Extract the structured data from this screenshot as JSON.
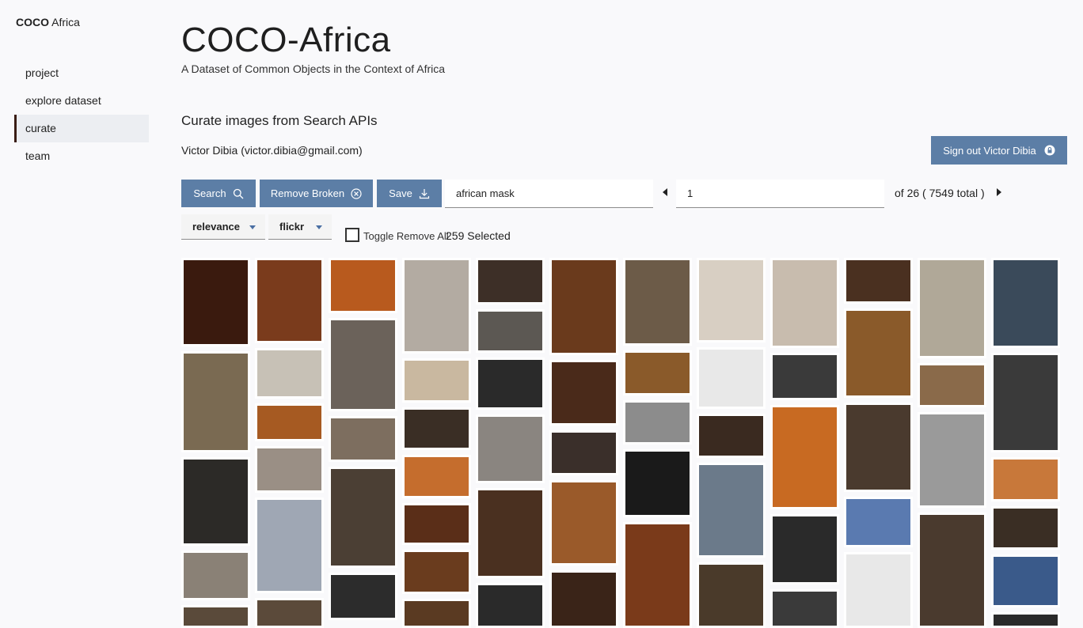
{
  "brand": {
    "bold": "COCO",
    "rest": "Africa"
  },
  "nav": {
    "items": [
      {
        "label": "project"
      },
      {
        "label": "explore dataset"
      },
      {
        "label": "curate"
      },
      {
        "label": "team"
      }
    ]
  },
  "header": {
    "title": "COCO-Africa",
    "subtitle": "A Dataset of Common Objects in the Context of Africa"
  },
  "curate": {
    "section_title": "Curate images from Search APIs",
    "user": "Victor Dibia (victor.dibia@gmail.com)",
    "signout_label": "Sign out Victor Dibia"
  },
  "toolbar": {
    "search_label": "Search",
    "remove_broken_label": "Remove Broken",
    "save_label": "Save",
    "query_value": "african mask",
    "page_value": "1",
    "of_total": "of 26 ( 7549 total )",
    "sort_value": "relevance",
    "source_value": "flickr",
    "toggle_label": "Toggle Remove All",
    "selected_text": "259 Selected"
  },
  "colors": {
    "accent": "#5c7ea6",
    "active_nav": "#3a1d14"
  },
  "icons": [
    "search-icon",
    "close-circle-icon",
    "download-icon",
    "lock-icon",
    "caret-left-icon",
    "caret-right-icon",
    "chevron-down-icon"
  ],
  "grid": {
    "columns": [
      [
        [
          115,
          "#3a1a0e"
        ],
        [
          130,
          "#7a6a52"
        ],
        [
          115,
          "#2c2a27"
        ],
        [
          64,
          "#8a8176"
        ],
        [
          30,
          "#5a4a3a"
        ]
      ],
      [
        [
          115,
          "#7a3b1c"
        ],
        [
          68,
          "#c7c1b6"
        ],
        [
          52,
          "#a65a22"
        ],
        [
          62,
          "#9a8f85"
        ],
        [
          130,
          "#9fa7b4"
        ],
        [
          40,
          "#5b4a3a"
        ]
      ],
      [
        [
          70,
          "#b85a1e"
        ],
        [
          118,
          "#6b625a"
        ],
        [
          58,
          "#7d6e5f"
        ],
        [
          128,
          "#4b3f34"
        ],
        [
          60,
          "#2c2c2c"
        ]
      ],
      [
        [
          130,
          "#b3aba2"
        ],
        [
          60,
          "#c9b8a0"
        ],
        [
          58,
          "#3a2e25"
        ],
        [
          60,
          "#c56d2d"
        ],
        [
          56,
          "#5a2e18"
        ],
        [
          60,
          "#6a3c1e"
        ],
        [
          40,
          "#5a3a22"
        ]
      ],
      [
        [
          62,
          "#3d2f27"
        ],
        [
          58,
          "#5c5853"
        ],
        [
          70,
          "#2a2a2a"
        ],
        [
          92,
          "#8a8580"
        ],
        [
          120,
          "#4a3020"
        ],
        [
          60,
          "#2a2a2a"
        ]
      ],
      [
        [
          136,
          "#6a3a1c"
        ],
        [
          92,
          "#4a2a1a"
        ],
        [
          62,
          "#3a2f2a"
        ],
        [
          120,
          "#9a5a2a"
        ],
        [
          80,
          "#3a2418"
        ]
      ],
      [
        [
          116,
          "#6c5b48"
        ],
        [
          60,
          "#8a5a2a"
        ],
        [
          58,
          "#8c8c8c"
        ],
        [
          90,
          "#1a1a1a"
        ],
        [
          140,
          "#7a3a1a"
        ]
      ],
      [
        [
          116,
          "#d8cfc3"
        ],
        [
          84,
          "#e8e8e8"
        ],
        [
          60,
          "#3a2a20"
        ],
        [
          130,
          "#6b7a8a"
        ],
        [
          90,
          "#4a3a2a"
        ]
      ],
      [
        [
          116,
          "#c8bcae"
        ],
        [
          60,
          "#3a3a3a"
        ],
        [
          134,
          "#c86a22"
        ],
        [
          90,
          "#2a2a2a"
        ],
        [
          50,
          "#3a3a3a"
        ]
      ],
      [
        [
          60,
          "#4a3020"
        ],
        [
          118,
          "#8a5a2a"
        ],
        [
          118,
          "#4a3a2e"
        ],
        [
          66,
          "#5a7ab0"
        ],
        [
          100,
          "#e8e8e8"
        ]
      ],
      [
        [
          130,
          "#b0a898"
        ],
        [
          58,
          "#8a6a4a"
        ],
        [
          124,
          "#9a9a9a"
        ],
        [
          150,
          "#4a3a2e"
        ]
      ],
      [
        [
          118,
          "#3a4a5a"
        ],
        [
          130,
          "#3a3a3a"
        ],
        [
          58,
          "#c8783a"
        ],
        [
          56,
          "#3a2e24"
        ],
        [
          70,
          "#3a5a8a"
        ],
        [
          20,
          "#2a2a2a"
        ]
      ]
    ]
  }
}
